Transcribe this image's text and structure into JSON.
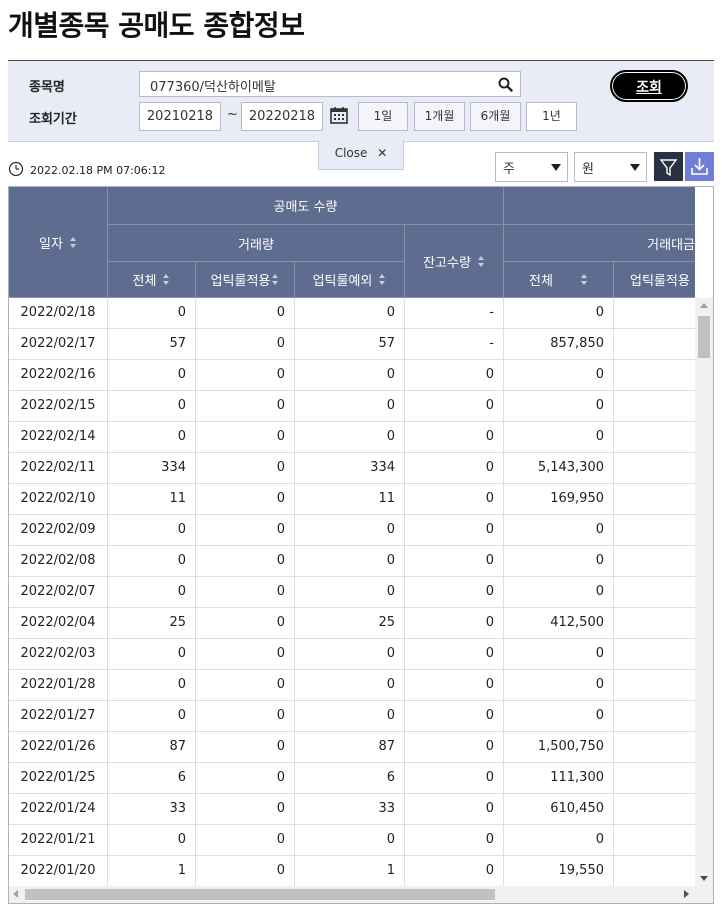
{
  "title": "개별종목 공매도 종합정보",
  "search": {
    "stock_label": "종목명",
    "stock_value": "077360/덕산하이메탈",
    "period_label": "조회기간",
    "query_label": "조회",
    "start_date": "20210218",
    "tilde": "~",
    "end_date": "20220218",
    "period_buttons": [
      "1일",
      "1개월",
      "6개월",
      "1년"
    ],
    "close_label": "Close"
  },
  "toolbar": {
    "timestamp": "2022.02.18 PM 07:06:12",
    "unit_select": "주",
    "currency_select": "원"
  },
  "table": {
    "headers": {
      "date": "일자",
      "short_volume": "공매도 수량",
      "trade_volume": "거래량",
      "balance_volume": "잔고수량",
      "trade_amount": "거래대금",
      "total": "전체",
      "uptick_applied": "업틱룰적용",
      "uptick_exempt": "업틱룰예외",
      "total2": "전체",
      "uptick_applied2": "업틱룰적용"
    },
    "rows": [
      [
        "2022/02/18",
        "0",
        "0",
        "0",
        "-",
        "0",
        ""
      ],
      [
        "2022/02/17",
        "57",
        "0",
        "57",
        "-",
        "857,850",
        ""
      ],
      [
        "2022/02/16",
        "0",
        "0",
        "0",
        "0",
        "0",
        ""
      ],
      [
        "2022/02/15",
        "0",
        "0",
        "0",
        "0",
        "0",
        ""
      ],
      [
        "2022/02/14",
        "0",
        "0",
        "0",
        "0",
        "0",
        ""
      ],
      [
        "2022/02/11",
        "334",
        "0",
        "334",
        "0",
        "5,143,300",
        ""
      ],
      [
        "2022/02/10",
        "11",
        "0",
        "11",
        "0",
        "169,950",
        ""
      ],
      [
        "2022/02/09",
        "0",
        "0",
        "0",
        "0",
        "0",
        ""
      ],
      [
        "2022/02/08",
        "0",
        "0",
        "0",
        "0",
        "0",
        ""
      ],
      [
        "2022/02/07",
        "0",
        "0",
        "0",
        "0",
        "0",
        ""
      ],
      [
        "2022/02/04",
        "25",
        "0",
        "25",
        "0",
        "412,500",
        ""
      ],
      [
        "2022/02/03",
        "0",
        "0",
        "0",
        "0",
        "0",
        ""
      ],
      [
        "2022/01/28",
        "0",
        "0",
        "0",
        "0",
        "0",
        ""
      ],
      [
        "2022/01/27",
        "0",
        "0",
        "0",
        "0",
        "0",
        ""
      ],
      [
        "2022/01/26",
        "87",
        "0",
        "87",
        "0",
        "1,500,750",
        ""
      ],
      [
        "2022/01/25",
        "6",
        "0",
        "6",
        "0",
        "111,300",
        ""
      ],
      [
        "2022/01/24",
        "33",
        "0",
        "33",
        "0",
        "610,450",
        ""
      ],
      [
        "2022/01/21",
        "0",
        "0",
        "0",
        "0",
        "0",
        ""
      ],
      [
        "2022/01/20",
        "1",
        "0",
        "1",
        "0",
        "19,550",
        ""
      ]
    ]
  },
  "colors": {
    "header_bg": "#5e6c8f",
    "panel_bg": "#e9ebf7",
    "download_btn": "#6f7fd6"
  }
}
